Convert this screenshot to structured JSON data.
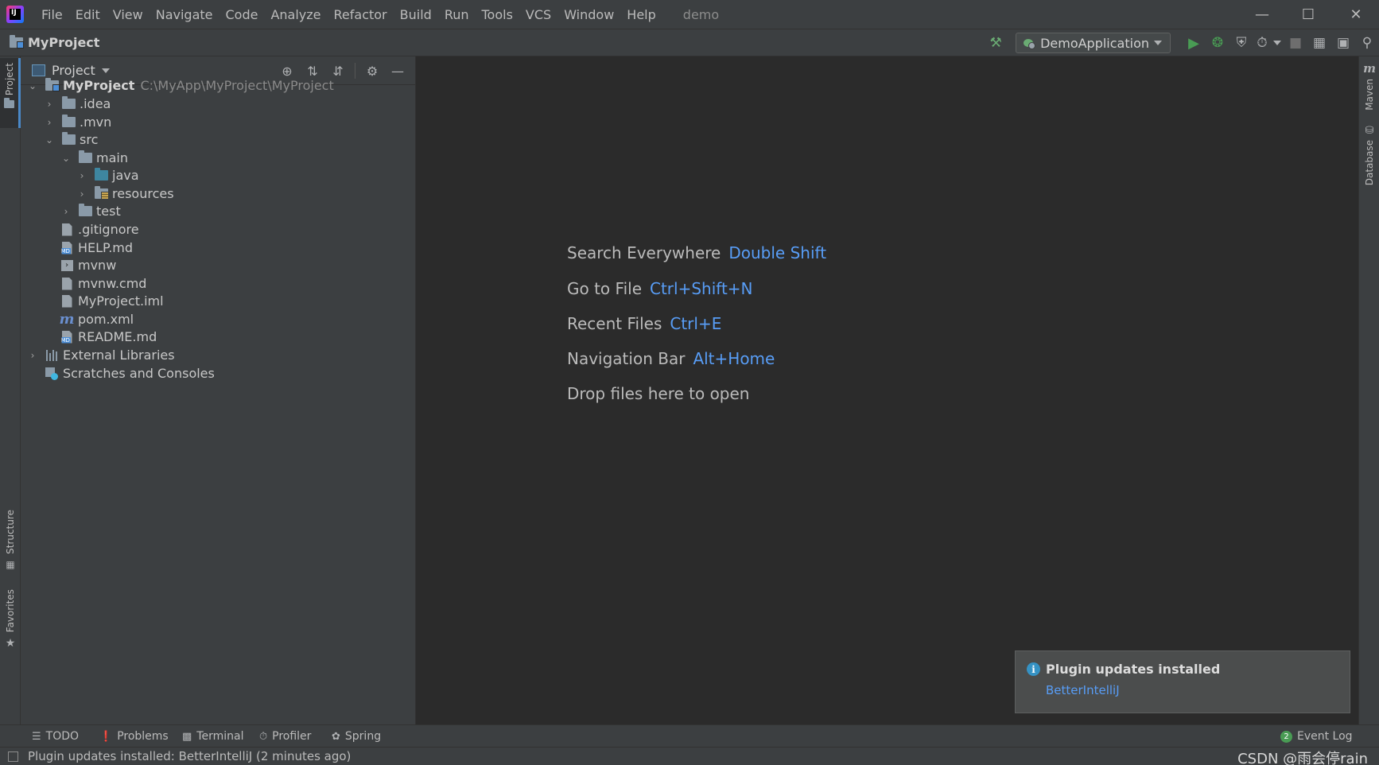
{
  "menubar": {
    "items": [
      "File",
      "Edit",
      "View",
      "Navigate",
      "Code",
      "Analyze",
      "Refactor",
      "Build",
      "Run",
      "Tools",
      "VCS",
      "Window",
      "Help"
    ],
    "window_title": "demo"
  },
  "navbar": {
    "project_name": "MyProject",
    "run_config": "DemoApplication"
  },
  "project_panel": {
    "title": "Project",
    "tree": [
      {
        "label": "MyProject",
        "path": "C:\\MyApp\\MyProject\\MyProject",
        "expanded": true
      },
      {
        "label": ".idea"
      },
      {
        "label": ".mvn"
      },
      {
        "label": "src"
      },
      {
        "label": "main"
      },
      {
        "label": "java"
      },
      {
        "label": "resources"
      },
      {
        "label": "test"
      },
      {
        "label": ".gitignore"
      },
      {
        "label": "HELP.md"
      },
      {
        "label": "mvnw"
      },
      {
        "label": "mvnw.cmd"
      },
      {
        "label": "MyProject.iml"
      },
      {
        "label": "pom.xml"
      },
      {
        "label": "README.md"
      },
      {
        "label": "External Libraries"
      },
      {
        "label": "Scratches and Consoles"
      }
    ]
  },
  "side_tabs": {
    "left": [
      "Project",
      "Structure",
      "Favorites"
    ],
    "right": [
      "Maven",
      "Database"
    ]
  },
  "editor_hints": [
    {
      "text": "Search Everywhere",
      "key": "Double Shift"
    },
    {
      "text": "Go to File",
      "key": "Ctrl+Shift+N"
    },
    {
      "text": "Recent Files",
      "key": "Ctrl+E"
    },
    {
      "text": "Navigation Bar",
      "key": "Alt+Home"
    },
    {
      "text": "Drop files here to open",
      "key": ""
    }
  ],
  "notification": {
    "title": "Plugin updates installed",
    "link": "BetterIntelliJ"
  },
  "bottom_bar": {
    "tabs": [
      "TODO",
      "Problems",
      "Terminal",
      "Profiler",
      "Spring"
    ],
    "event_log": "Event Log",
    "event_count": "2"
  },
  "status_bar": {
    "message": "Plugin updates installed: BetterIntelliJ (2 minutes ago)",
    "watermark": "CSDN @雨会停rain"
  },
  "colors": {
    "accent_link": "#589df6",
    "background": "#2b2b2b",
    "panel": "#3c3f41",
    "run_green": "#499c54"
  }
}
